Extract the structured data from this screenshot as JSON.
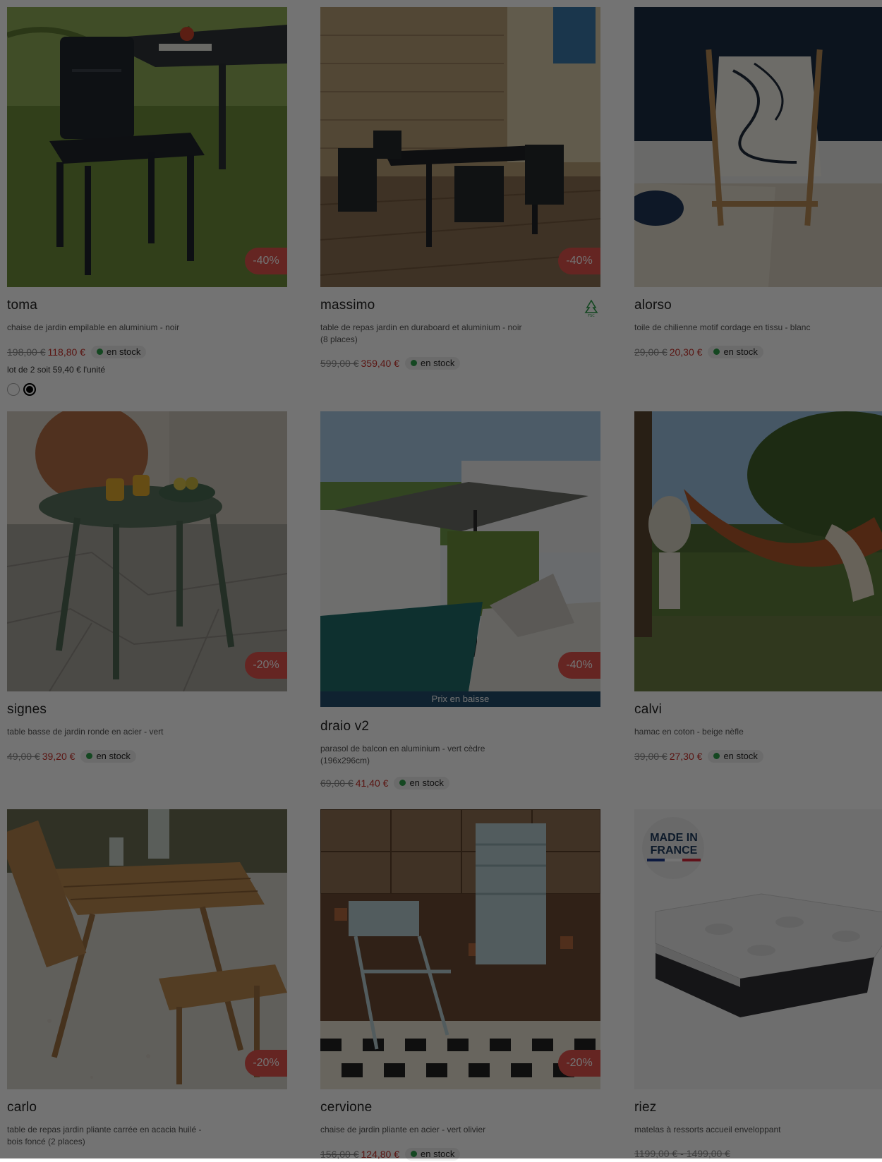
{
  "products": [
    {
      "name": "toma",
      "desc": "chaise de jardin empilable en aluminium - noir",
      "old_price": "198,00 €",
      "new_price": "118,80 €",
      "discount": "-40%",
      "stock": "en stock",
      "unit_note": "lot de 2 soit 59,40 € l'unité",
      "swatches": [
        "#ffffff",
        "#000000"
      ]
    },
    {
      "name": "massimo",
      "desc": "table de repas jardin en duraboard et aluminium - noir (8 places)",
      "old_price": "599,00 €",
      "new_price": "359,40 €",
      "discount": "-40%",
      "stock": "en stock",
      "badge": "fsc-icon"
    },
    {
      "name": "alorso",
      "desc": "toile de chilienne motif cordage en tissu - blanc",
      "old_price": "29,00 €",
      "new_price": "20,30 €",
      "stock": "en stock"
    },
    {
      "name": "signes",
      "desc": "table basse de jardin ronde en acier - vert",
      "old_price": "49,00 €",
      "new_price": "39,20 €",
      "discount": "-20%",
      "stock": "en stock"
    },
    {
      "name": "draio v2",
      "desc": "parasol de balcon en aluminium - vert cèdre (196x296cm)",
      "old_price": "69,00 €",
      "new_price": "41,40 €",
      "discount": "-40%",
      "stock": "en stock",
      "ribbon": "Prix en baisse"
    },
    {
      "name": "calvi",
      "desc": "hamac en coton - beige nèfle",
      "old_price": "39,00 €",
      "new_price": "27,30 €",
      "stock": "en stock"
    },
    {
      "name": "carlo",
      "desc": "table de repas jardin pliante carrée en acacia huilé - bois foncé (2 places)",
      "discount": "-20%"
    },
    {
      "name": "cervione",
      "desc": "chaise de jardin pliante en acier - vert olivier",
      "old_price": "156,00 €",
      "new_price": "124,80 €",
      "discount": "-20%",
      "stock": "en stock"
    },
    {
      "name": "riez",
      "desc": "matelas à ressorts accueil enveloppant",
      "old_price": "1199,00 € - 1499,00 €",
      "badge_text": "MADE IN\nFRANCE"
    }
  ],
  "colors": {
    "discount": "#e1534d",
    "price": "#c8312b",
    "stock_dot": "#2e9e4a",
    "ribbon": "#234d6c",
    "overlay": "rgba(0,0,0,0.55)"
  }
}
